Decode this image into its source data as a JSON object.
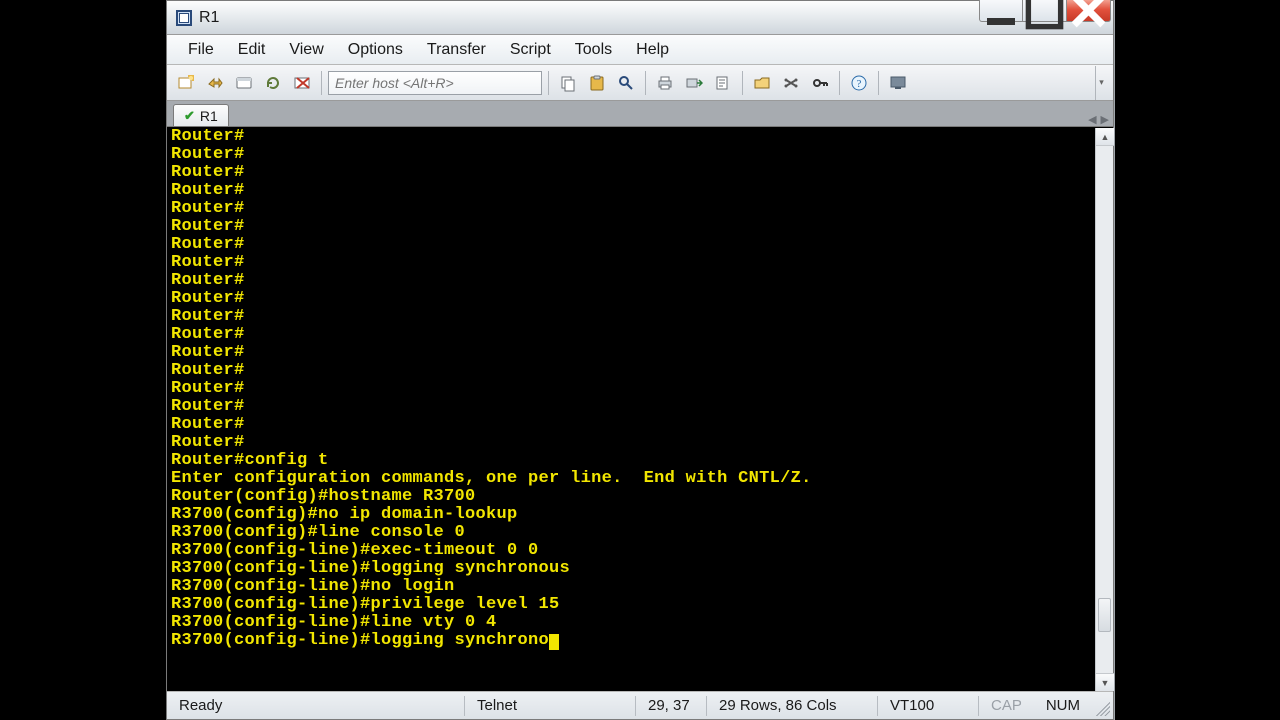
{
  "window": {
    "title": "R1"
  },
  "menu": {
    "items": [
      "File",
      "Edit",
      "View",
      "Options",
      "Transfer",
      "Script",
      "Tools",
      "Help"
    ]
  },
  "toolbar": {
    "host_placeholder": "Enter host <Alt+R>"
  },
  "tabs": {
    "active": {
      "label": "R1"
    }
  },
  "terminal": {
    "lines": [
      "Router#",
      "Router#",
      "Router#",
      "Router#",
      "Router#",
      "Router#",
      "Router#",
      "Router#",
      "Router#",
      "Router#",
      "Router#",
      "Router#",
      "Router#",
      "Router#",
      "Router#",
      "Router#",
      "Router#",
      "Router#",
      "Router#config t",
      "Enter configuration commands, one per line.  End with CNTL/Z.",
      "Router(config)#hostname R3700",
      "R3700(config)#no ip domain-lookup",
      "R3700(config)#line console 0",
      "R3700(config-line)#exec-timeout 0 0",
      "R3700(config-line)#logging synchronous",
      "R3700(config-line)#no login",
      "R3700(config-line)#privilege level 15",
      "R3700(config-line)#line vty 0 4",
      "R3700(config-line)#logging synchrono"
    ]
  },
  "status": {
    "ready": "Ready",
    "proto": "Telnet",
    "pos": "29, 37",
    "dims": "29 Rows, 86 Cols",
    "term": "VT100",
    "cap": "CAP",
    "num": "NUM"
  }
}
